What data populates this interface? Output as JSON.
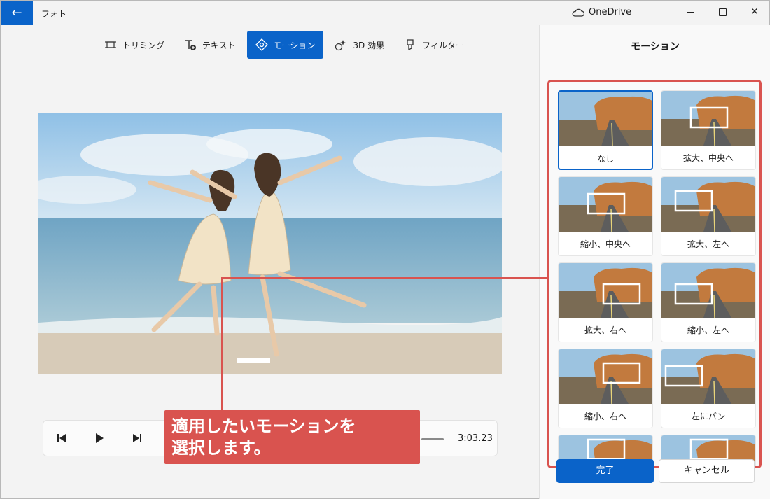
{
  "app": {
    "title": "フォト",
    "onedrive_label": "OneDrive"
  },
  "toolbar": {
    "items": [
      {
        "label": "トリミング",
        "icon": "crop-icon"
      },
      {
        "label": "テキスト",
        "icon": "text-add-icon"
      },
      {
        "label": "モーション",
        "icon": "motion-icon",
        "active": true
      },
      {
        "label": "3D 効果",
        "icon": "effects-3d-icon"
      },
      {
        "label": "フィルター",
        "icon": "filter-icon"
      }
    ]
  },
  "player": {
    "time": "3:03.23"
  },
  "callout": {
    "line1": "適用したいモーションを",
    "line2": "選択します。"
  },
  "panel": {
    "title": "モーション",
    "tiles": [
      {
        "label": "なし",
        "selected": true,
        "motion": "none"
      },
      {
        "label": "拡大、中央へ",
        "motion": "zoom-in-center"
      },
      {
        "label": "縮小、中央へ",
        "motion": "zoom-out-center"
      },
      {
        "label": "拡大、左へ",
        "motion": "zoom-in-left"
      },
      {
        "label": "拡大、右へ",
        "motion": "zoom-in-right"
      },
      {
        "label": "縮小、左へ",
        "motion": "zoom-out-left"
      },
      {
        "label": "縮小、右へ",
        "motion": "zoom-out-right"
      },
      {
        "label": "左にパン",
        "motion": "pan-left"
      },
      {
        "label": "",
        "motion": "partial"
      },
      {
        "label": "",
        "motion": "partial"
      }
    ],
    "done_label": "完了",
    "cancel_label": "キャンセル"
  },
  "colors": {
    "accent": "#0a63c9",
    "callout": "#d9534f"
  }
}
